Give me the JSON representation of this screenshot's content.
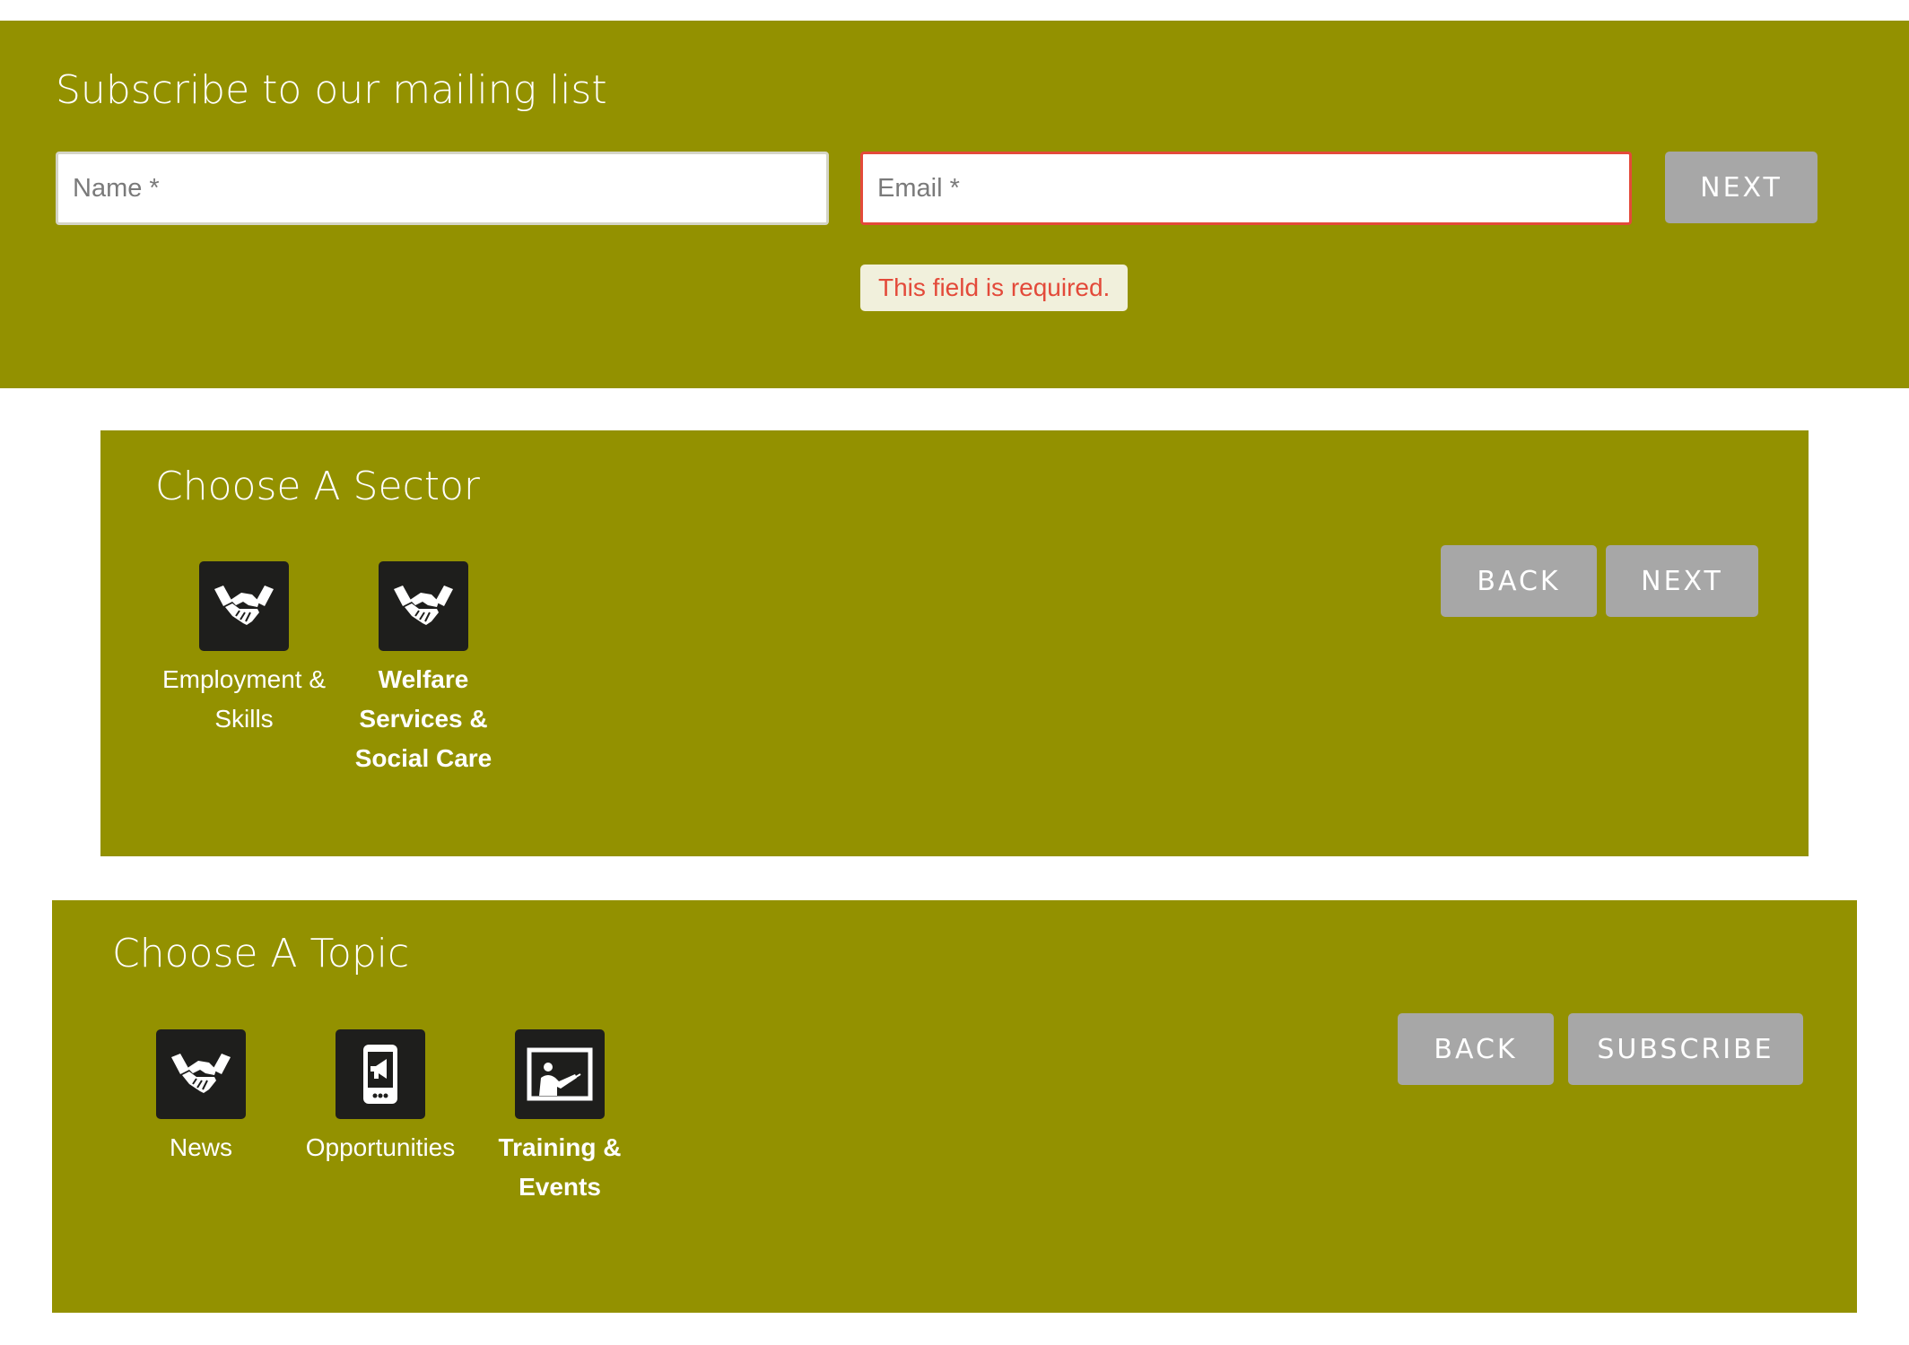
{
  "mailing": {
    "title": "Subscribe to our mailing list",
    "name_placeholder": "Name *",
    "name_value": "",
    "email_placeholder": "Email *",
    "email_value": "",
    "error_message": "This field is required.",
    "next_label": "NEXT"
  },
  "sector": {
    "title": "Choose A Sector",
    "back_label": "BACK",
    "next_label": "NEXT",
    "options": [
      {
        "label": "Employment & Skills",
        "icon": "handshake-icon",
        "selected": false
      },
      {
        "label": "Welfare Services & Social Care",
        "icon": "handshake-icon",
        "selected": true
      }
    ]
  },
  "topic": {
    "title": "Choose A Topic",
    "back_label": "BACK",
    "subscribe_label": "SUBSCRIBE",
    "options": [
      {
        "label": "News",
        "icon": "handshake-icon",
        "selected": false
      },
      {
        "label": "Opportunities",
        "icon": "mobile-megaphone-icon",
        "selected": false
      },
      {
        "label": "Training & Events",
        "icon": "presentation-board-icon",
        "selected": true
      }
    ]
  },
  "colors": {
    "panel_background": "#939100",
    "button_background": "#a7a7a7",
    "tile_background": "#1e1e1c",
    "error": "#e34a3a",
    "error_tip_background": "#f1f0dc"
  }
}
